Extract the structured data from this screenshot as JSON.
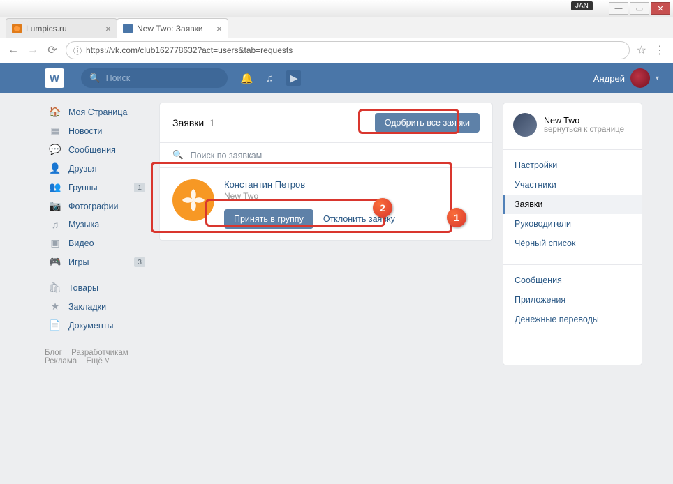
{
  "browser": {
    "badge": "JAN",
    "tabs": [
      {
        "title": "Lumpics.ru",
        "active": false
      },
      {
        "title": "New Two: Заявки",
        "active": true
      }
    ],
    "url": "https://vk.com/club162778632?act=users&tab=requests"
  },
  "header": {
    "logo": "W",
    "search_placeholder": "Поиск",
    "username": "Андрей"
  },
  "left_nav": {
    "items": [
      {
        "icon": "🏠",
        "label": "Моя Страница"
      },
      {
        "icon": "▦",
        "label": "Новости"
      },
      {
        "icon": "💬",
        "label": "Сообщения"
      },
      {
        "icon": "👤",
        "label": "Друзья"
      },
      {
        "icon": "👥",
        "label": "Группы",
        "count": "1"
      },
      {
        "icon": "📷",
        "label": "Фотографии"
      },
      {
        "icon": "♫",
        "label": "Музыка"
      },
      {
        "icon": "▣",
        "label": "Видео"
      },
      {
        "icon": "🎮",
        "label": "Игры",
        "count": "3"
      }
    ],
    "items2": [
      {
        "icon": "🛍",
        "label": "Товары"
      },
      {
        "icon": "★",
        "label": "Закладки"
      },
      {
        "icon": "📄",
        "label": "Документы"
      }
    ],
    "footer": [
      "Блог",
      "Разработчикам",
      "Реклама",
      "Ещё ˅"
    ]
  },
  "content": {
    "title": "Заявки",
    "count": "1",
    "approve_all": "Одобрить все заявки",
    "search_placeholder": "Поиск по заявкам",
    "request": {
      "name": "Константин Петров",
      "sub": "New Two",
      "accept": "Принять в группу",
      "decline": "Отклонить заявку"
    }
  },
  "right": {
    "group_name": "New Two",
    "back": "вернуться к странице",
    "menu1": [
      "Настройки",
      "Участники",
      "Заявки",
      "Руководители",
      "Чёрный список"
    ],
    "menu2": [
      "Сообщения",
      "Приложения",
      "Денежные переводы"
    ],
    "active": "Заявки"
  },
  "annotations": {
    "n1": "1",
    "n2": "2"
  }
}
